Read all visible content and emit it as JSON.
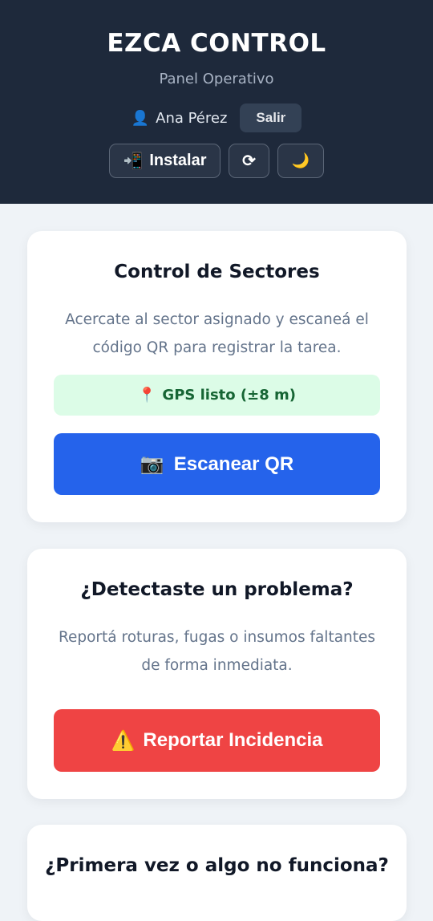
{
  "header": {
    "title": "EZCA CONTROL",
    "subtitle": "Panel Operativo",
    "user_icon": "👤",
    "user_name": "Ana Pérez",
    "logout_label": "Salir",
    "install_icon": "📲",
    "install_label": "Instalar",
    "refresh_icon": "⟳",
    "theme_icon": "🌙"
  },
  "sectors_card": {
    "title": "Control de Sectores",
    "description": "Acercate al sector asignado y escaneá el código QR para registrar la tarea.",
    "gps_icon": "📍",
    "gps_status": "GPS listo (±8 m)",
    "scan_icon": "📷",
    "scan_label": "Escanear QR"
  },
  "incident_card": {
    "title": "¿Detectaste un problema?",
    "description": "Reportá roturas, fugas o insumos faltantes de forma inmediata.",
    "report_icon": "⚠️",
    "report_label": "Reportar Incidencia"
  },
  "help_card": {
    "title": "¿Primera vez o algo no funciona?"
  },
  "colors": {
    "header_bg": "#1e293b",
    "scan_button": "#2563eb",
    "report_button": "#ef4444",
    "gps_bg": "#dcfce7",
    "gps_text": "#166534"
  }
}
